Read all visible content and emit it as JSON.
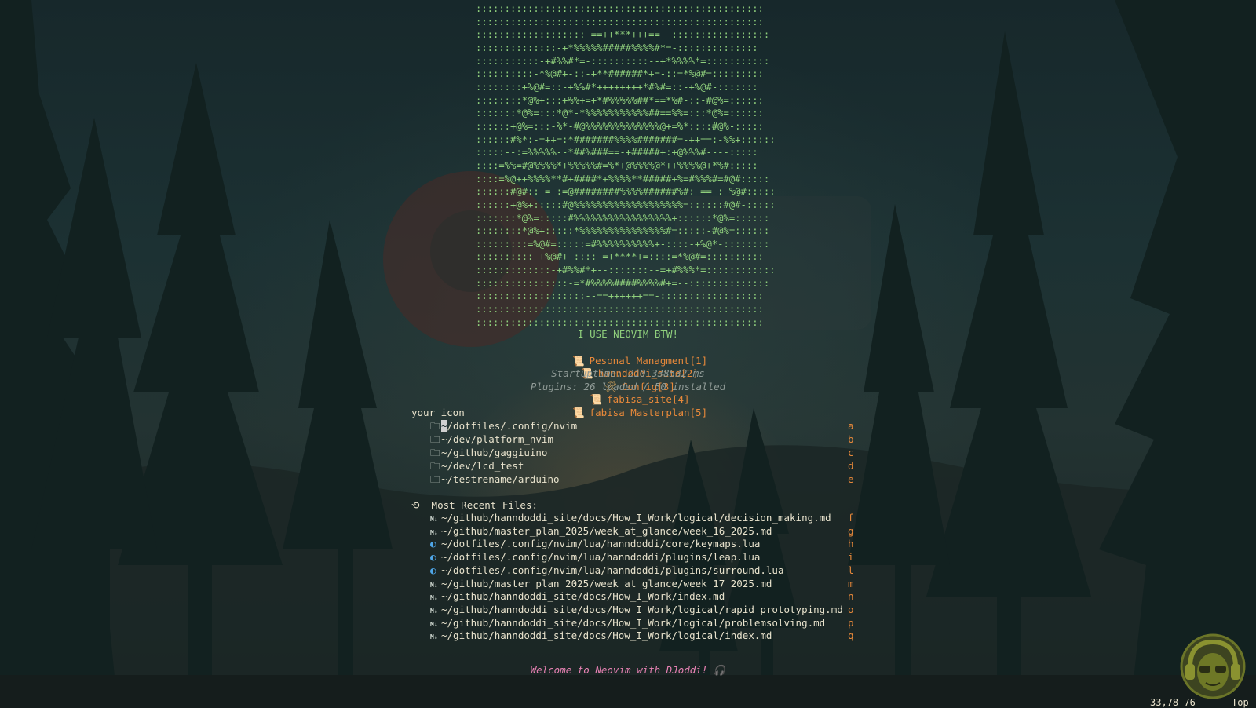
{
  "ascii_art": [
    "::::::::::::::::::::::::::::::::::::::::::::::::::",
    "::::::::::::::::::::::::::::::::::::::::::::::::::",
    ":::::::::::::::::::-==++***+++==--:::::::::::::::::",
    "::::::::::::::-+*%%%%%#####%%%%#*=-::::::::::::::",
    ":::::::::::-+#%%#*=-::::::::::--+*%%%%*=:::::::::::",
    "::::::::::-*%@#+-::-+**######*+=-::=*%@#=:::::::::",
    "::::::::+%@#=::-+%%#*++++++++*#%#=::-+%@#-:::::::",
    "::::::::*@%+:::+%%+=+*#%%%%%##*==*%#-::-#@%=::::::",
    ":::::::*@%=:::*@*-*%%%%%%%%%%%##==%%=:::*@%=::::::",
    "::::::+@%=:::-%*-#@%%%%%%%%%%%%%@+=%*::::#@%-:::::",
    "::::::#%*:-=++=:*#######%%%%#######=-++==:-%%+::::::",
    ":::::--:=%%%%%--*##%###==-+#####+:+@%%%#----:::::",
    "::::=%%=#@%%%%*+%%%%%#=%*+@%%%%@*++%%%%@+*%#:::::",
    "::::=%@++%%%%**#+####*+%%%%**#####+%=#%%%#=#@#:::::",
    "::::::#@#::-=-:=@########%%%%######%#:-==-:-%@#:::::",
    "::::::+@%+:::::#@%%%%%%%%%%%%%%%%%%%=::::::#@#-:::::",
    ":::::::*@%=:::::#%%%%%%%%%%%%%%%%%+::::::*@%=::::::",
    "::::::::*@%+:::::*%%%%%%%%%%%%%%%#=:::::-#@%=::::::",
    ":::::::::=%@#=:::::=#%%%%%%%%%%+-::::-+%@*-::::::::",
    "::::::::::-+%@#+-::::-=+****+=::::=*%@#=::::::::::",
    ":::::::::::::-+#%%#*+--:::::::--=+#%%%*=::::::::::::",
    "::::::::::::::::-=*#%%%%####%%%%#+=--::::::::::::::",
    ":::::::::::::::::::--==++++++==-::::::::::::::::::",
    "::::::::::::::::::::::::::::::::::::::::::::::::::",
    "::::::::::::::::::::::::::::::::::::::::::::::::::"
  ],
  "tagline": "I USE NEOVIM BTW!",
  "bookmarks": [
    {
      "icon": "📜",
      "label": "Pesonal Managment[1]"
    },
    {
      "icon": "📜",
      "label": "hanndoddi_site[2]"
    },
    {
      "icon": "🛠",
      "label": "Config[3]"
    },
    {
      "icon": "📜",
      "label": "fabisa_site[4]"
    },
    {
      "icon": "📜",
      "label": "fabisa Masterplan[5]"
    }
  ],
  "startuptime": "Startuptime: 210.338532 ms",
  "plugins": "Plugins: 26 loaded / 50 installed",
  "projects": {
    "title": "your icon",
    "items": [
      {
        "path": "~/dotfiles/.config/nvim",
        "key": "a"
      },
      {
        "path": "~/dev/platform_nvim",
        "key": "b"
      },
      {
        "path": "~/github/gaggiuino",
        "key": "c"
      },
      {
        "path": "~/dev/lcd_test",
        "key": "d"
      },
      {
        "path": "~/testrename/arduino",
        "key": "e"
      }
    ]
  },
  "recent": {
    "icon": "history-icon",
    "title": "Most Recent Files:",
    "items": [
      {
        "icon": "markdown",
        "path": "~/github/hanndoddi_site/docs/How_I_Work/logical/decision_making.md",
        "key": "f"
      },
      {
        "icon": "markdown",
        "path": "~/github/master_plan_2025/week_at_glance/week_16_2025.md",
        "key": "g"
      },
      {
        "icon": "lua",
        "path": "~/dotfiles/.config/nvim/lua/hanndoddi/core/keymaps.lua",
        "key": "h"
      },
      {
        "icon": "lua",
        "path": "~/dotfiles/.config/nvim/lua/hanndoddi/plugins/leap.lua",
        "key": "i"
      },
      {
        "icon": "lua",
        "path": "~/dotfiles/.config/nvim/lua/hanndoddi/plugins/surround.lua",
        "key": "l"
      },
      {
        "icon": "markdown",
        "path": "~/github/master_plan_2025/week_at_glance/week_17_2025.md",
        "key": "m"
      },
      {
        "icon": "markdown",
        "path": "~/github/hanndoddi_site/docs/How_I_Work/index.md",
        "key": "n"
      },
      {
        "icon": "markdown",
        "path": "~/github/hanndoddi_site/docs/How_I_Work/logical/rapid_prototyping.md",
        "key": "o"
      },
      {
        "icon": "markdown",
        "path": "~/github/hanndoddi_site/docs/How_I_Work/logical/problemsolving.md",
        "key": "p"
      },
      {
        "icon": "markdown",
        "path": "~/github/hanndoddi_site/docs/How_I_Work/logical/index.md",
        "key": "q"
      }
    ]
  },
  "footer": "Welcome to Neovim with DJoddi! 🎧",
  "status": {
    "position": "33,78-76",
    "scroll": "Top"
  },
  "colors": {
    "accent": "#e8893a",
    "art": "#8fcf7c",
    "muted": "#8f9a96",
    "footer": "#e882b4",
    "lua": "#4fa6e8"
  }
}
